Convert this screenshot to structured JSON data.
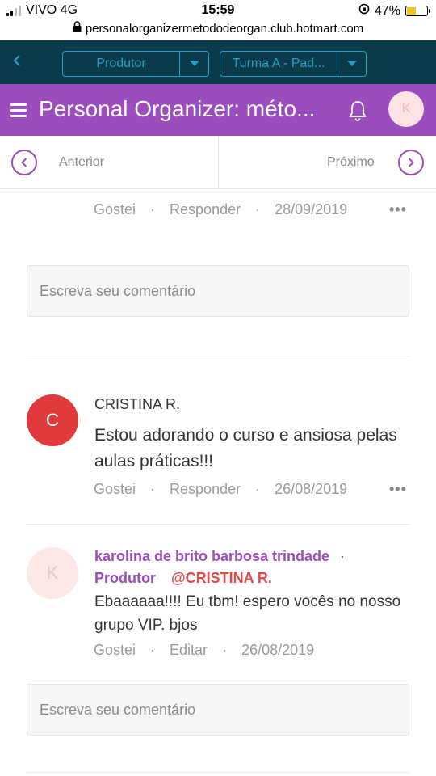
{
  "status_bar": {
    "carrier": "VIVO 4G",
    "time": "15:59",
    "battery": "47%",
    "battery_level": 0.47
  },
  "url_bar": {
    "url": "personalorganizermetododeorgan.club.hotmart.com"
  },
  "top_nav": {
    "select_1": "Produtor",
    "select_2": "Turma A - Pad..."
  },
  "header": {
    "title": "Personal Organizer: méto...",
    "avatar_initial": "K"
  },
  "pager": {
    "prev_label": "Anterior",
    "next_label": "Próximo"
  },
  "actions": {
    "like": "Gostei",
    "reply": "Responder",
    "edit": "Editar",
    "separator": "·",
    "more": "•••"
  },
  "comment_input": {
    "placeholder": "Escreva seu comentário"
  },
  "previous_comment": {
    "date": "28/09/2019"
  },
  "comment": {
    "avatar_initial": "C",
    "author": "CRISTINA R.",
    "text_line_1": "Estou adorando o curso e ansiosa pelas",
    "text_line_2": "aulas práticas!!!",
    "date": "26/08/2019"
  },
  "reply": {
    "avatar_initial": "K",
    "author": "karolina de brito barbosa trindade",
    "separator": "·",
    "role": "Produtor",
    "mention": "@CRISTINA R.",
    "text_line_1": "Ebaaaaaa!!!! Eu tbm! espero vocês no nosso",
    "text_line_2": "grupo VIP. bjos",
    "date": "26/08/2019"
  },
  "colors": {
    "purple": "#9b4dbe",
    "dark_nav": "#0b3b4a",
    "accent_blue": "#2a9cc4",
    "avatar_red": "#e03a3a"
  }
}
